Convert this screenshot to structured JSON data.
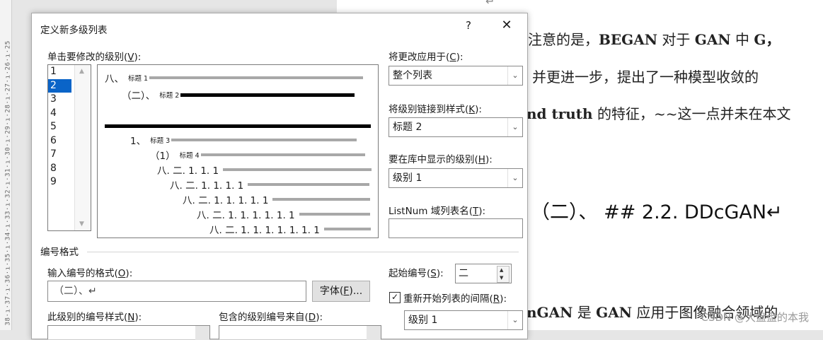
{
  "ruler": {
    "text": "38·ı·37·ı·36·ı·35·ı·34·ı·33·ı·32·ı·31·ı·30·ı·29·ı·28·ı·27·ı·26·ı·25"
  },
  "document": {
    "return_mark": "↵",
    "line1_a": "注意的是，",
    "line1_b": "BEGAN",
    "line1_c": " 对于 ",
    "line1_d": "GAN",
    "line1_e": " 中 ",
    "line1_f": "G，",
    "line2": "并更进一步，提出了一种模型收敛的",
    "line3_a": "nd truth",
    "line3_b": " 的特征，~~这一点并未在本文",
    "heading": "（二）、 ## 2.2. DDcGAN↵",
    "line4_a": "nGAN",
    "line4_b": " 是 ",
    "line4_c": "GAN",
    "line4_d": " 应用于图像融合领域的",
    "watermark": "CSDN @大盘盘的本我"
  },
  "dialog": {
    "title": "定义新多级列表",
    "help": "?",
    "close": "✕",
    "level_label": "单击要修改的级别(V):",
    "levels": [
      "1",
      "2",
      "3",
      "4",
      "5",
      "6",
      "7",
      "8",
      "9"
    ],
    "selected_level": "2",
    "preview": {
      "rows": [
        {
          "num": "八、",
          "label": "标题 1"
        },
        {
          "num": "（二）、",
          "label": "标题 2"
        },
        {
          "num": "1、",
          "label": "标题 3"
        },
        {
          "num": "（1）",
          "label": "标题 4"
        },
        {
          "num": "八. 二. 1. 1. 1",
          "label": ""
        },
        {
          "num": "八. 二. 1. 1. 1. 1",
          "label": ""
        },
        {
          "num": "八. 二. 1. 1. 1. 1. 1",
          "label": ""
        },
        {
          "num": "八. 二. 1. 1. 1. 1. 1. 1",
          "label": ""
        },
        {
          "num": "八. 二. 1. 1. 1. 1. 1. 1. 1",
          "label": ""
        }
      ]
    },
    "apply_to_label": "将更改应用于(C):",
    "apply_to_value": "整个列表",
    "link_style_label": "将级别链接到样式(K):",
    "link_style_value": "标题 2",
    "gallery_level_label": "要在库中显示的级别(H):",
    "gallery_level_value": "级别 1",
    "listnum_label": "ListNum 域列表名(T):",
    "listnum_value": "",
    "section_title": "编号格式",
    "format_label": "输入编号的格式(O):",
    "format_value": "（二）、↵",
    "font_button": "字体(F)...",
    "start_at_label": "起始编号(S):",
    "start_at_value": "二",
    "restart_label": "重新开始列表的间隔(R):",
    "restart_checked": "✓",
    "restart_value": "级别 1",
    "style_label": "此级别的编号样式(N):",
    "include_label": "包含的级别编号来自(D):",
    "arrow": "⌄"
  }
}
